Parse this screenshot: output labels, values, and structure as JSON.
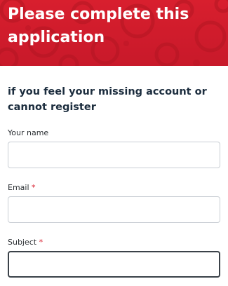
{
  "banner": {
    "title": "Please complete this application",
    "pattern": "decorative-circles",
    "color": "#d81f2e"
  },
  "form": {
    "subheading": "if you feel your missing account or cannot register",
    "fields": [
      {
        "label": "Your name",
        "required": false,
        "value": "",
        "placeholder": ""
      },
      {
        "label": "Email",
        "required": true,
        "value": "",
        "placeholder": ""
      },
      {
        "label": "Subject",
        "required": true,
        "value": "",
        "placeholder": ""
      }
    ],
    "required_marker": "*",
    "required_color": "#d81f2e"
  }
}
